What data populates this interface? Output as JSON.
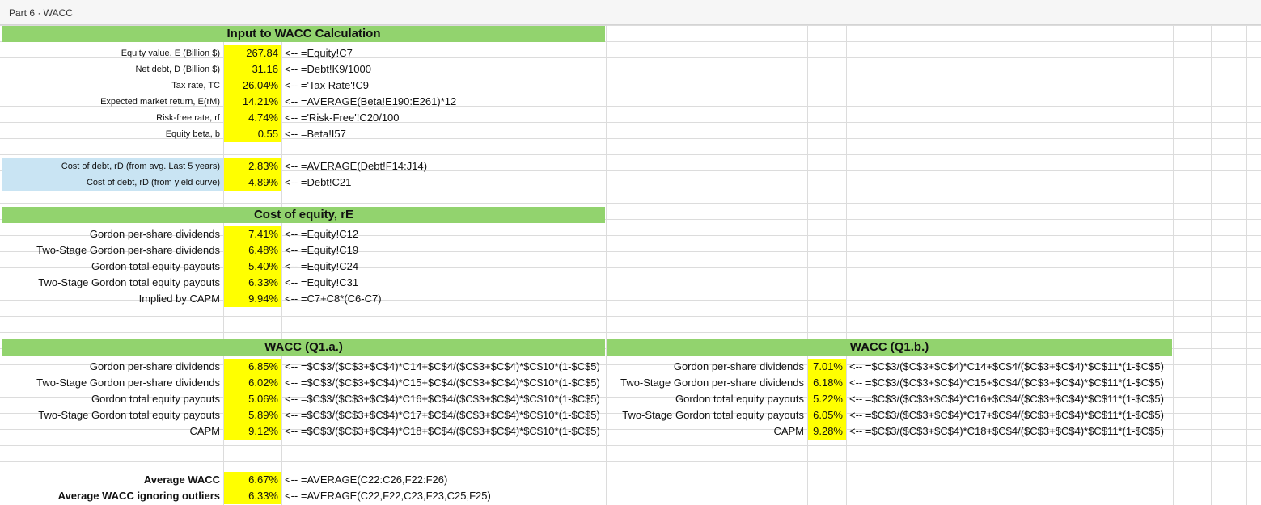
{
  "window": {
    "title": "Part 6 · WACC"
  },
  "sections": {
    "inputs": {
      "title": "Input to WACC Calculation",
      "rows": [
        {
          "label": "Equity value, E (Billion $)",
          "value": "267.84",
          "formula": "<-- =Equity!C7"
        },
        {
          "label": "Net debt, D (Billion $)",
          "value": "31.16",
          "formula": "<-- =Debt!K9/1000"
        },
        {
          "label": "Tax rate, TC",
          "value": "26.04%",
          "formula": "<-- ='Tax Rate'!C9"
        },
        {
          "label": "Expected market return, E(rM)",
          "value": "14.21%",
          "formula": "<-- =AVERAGE(Beta!E190:E261)*12"
        },
        {
          "label": "Risk-free rate, rf",
          "value": "4.74%",
          "formula": "<-- ='Risk-Free'!C20/100"
        },
        {
          "label": "Equity beta, b",
          "value": "0.55",
          "formula": "<-- =Beta!I57"
        }
      ]
    },
    "cost_of_debt": {
      "rows": [
        {
          "label": "Cost of debt, rD (from avg. Last 5 years)",
          "value": "2.83%",
          "formula": "<-- =AVERAGE(Debt!F14:J14)"
        },
        {
          "label": "Cost of debt, rD (from yield curve)",
          "value": "4.89%",
          "formula": "<-- =Debt!C21"
        }
      ]
    },
    "cost_of_equity": {
      "title": "Cost of equity, rE",
      "rows": [
        {
          "label": "Gordon per-share dividends",
          "value": "7.41%",
          "formula": "<-- =Equity!C12"
        },
        {
          "label": "Two-Stage Gordon per-share dividends",
          "value": "6.48%",
          "formula": "<-- =Equity!C19"
        },
        {
          "label": "Gordon total equity payouts",
          "value": "5.40%",
          "formula": "<-- =Equity!C24"
        },
        {
          "label": "Two-Stage Gordon total equity payouts",
          "value": "6.33%",
          "formula": "<-- =Equity!C31"
        },
        {
          "label": "Implied by CAPM",
          "value": "9.94%",
          "formula": "<-- =C7+C8*(C6-C7)"
        }
      ]
    },
    "wacc_a": {
      "title": "WACC (Q1.a.)",
      "rows": [
        {
          "label": "Gordon per-share dividends",
          "value": "6.85%",
          "formula": "<-- =$C$3/($C$3+$C$4)*C14+$C$4/($C$3+$C$4)*$C$10*(1-$C$5)"
        },
        {
          "label": "Two-Stage Gordon per-share dividends",
          "value": "6.02%",
          "formula": "<-- =$C$3/($C$3+$C$4)*C15+$C$4/($C$3+$C$4)*$C$10*(1-$C$5)"
        },
        {
          "label": "Gordon total equity payouts",
          "value": "5.06%",
          "formula": "<-- =$C$3/($C$3+$C$4)*C16+$C$4/($C$3+$C$4)*$C$10*(1-$C$5)"
        },
        {
          "label": "Two-Stage Gordon total equity payouts",
          "value": "5.89%",
          "formula": "<-- =$C$3/($C$3+$C$4)*C17+$C$4/($C$3+$C$4)*$C$10*(1-$C$5)"
        },
        {
          "label": "CAPM",
          "value": "9.12%",
          "formula": "<-- =$C$3/($C$3+$C$4)*C18+$C$4/($C$3+$C$4)*$C$10*(1-$C$5)"
        }
      ]
    },
    "wacc_b": {
      "title": "WACC (Q1.b.)",
      "rows": [
        {
          "label": "Gordon per-share dividends",
          "value": "7.01%",
          "formula": "<-- =$C$3/($C$3+$C$4)*C14+$C$4/($C$3+$C$4)*$C$11*(1-$C$5)"
        },
        {
          "label": "Two-Stage Gordon per-share dividends",
          "value": "6.18%",
          "formula": "<-- =$C$3/($C$3+$C$4)*C15+$C$4/($C$3+$C$4)*$C$11*(1-$C$5)"
        },
        {
          "label": "Gordon total equity payouts",
          "value": "5.22%",
          "formula": "<-- =$C$3/($C$3+$C$4)*C16+$C$4/($C$3+$C$4)*$C$11*(1-$C$5)"
        },
        {
          "label": "Two-Stage Gordon total equity payouts",
          "value": "6.05%",
          "formula": "<-- =$C$3/($C$3+$C$4)*C17+$C$4/($C$3+$C$4)*$C$11*(1-$C$5)"
        },
        {
          "label": "CAPM",
          "value": "9.28%",
          "formula": "<-- =$C$3/($C$3+$C$4)*C18+$C$4/($C$3+$C$4)*$C$11*(1-$C$5)"
        }
      ]
    },
    "summary": {
      "rows": [
        {
          "label": "Average WACC",
          "value": "6.67%",
          "formula": "<-- =AVERAGE(C22:C26,F22:F26)"
        },
        {
          "label": "Average WACC ignoring outliers",
          "value": "6.33%",
          "formula": "<-- =AVERAGE(C22,F22,C23,F23,C25,F25)"
        }
      ]
    }
  },
  "colors": {
    "header_fill": "#92d36e",
    "value_fill": "#ffff00",
    "debt_label_fill": "#c9e4f3",
    "gridline": "#dcdcdc"
  }
}
